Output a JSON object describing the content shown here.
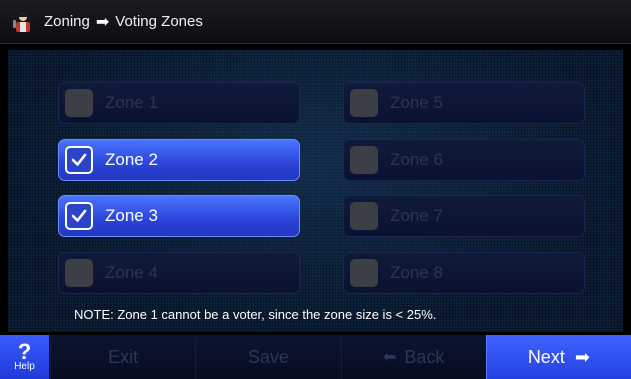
{
  "header": {
    "icon": "technician-icon",
    "crumb_1": "Zoning",
    "crumb_arrow": "➡",
    "crumb_2": "Voting Zones"
  },
  "zones": [
    {
      "label": "Zone 1",
      "checked": false,
      "enabled": false
    },
    {
      "label": "Zone 2",
      "checked": true,
      "enabled": true
    },
    {
      "label": "Zone 3",
      "checked": true,
      "enabled": true
    },
    {
      "label": "Zone 4",
      "checked": false,
      "enabled": false
    },
    {
      "label": "Zone 5",
      "checked": false,
      "enabled": false
    },
    {
      "label": "Zone 6",
      "checked": false,
      "enabled": false
    },
    {
      "label": "Zone 7",
      "checked": false,
      "enabled": false
    },
    {
      "label": "Zone 8",
      "checked": false,
      "enabled": false
    }
  ],
  "note": "NOTE: Zone 1 cannot be a voter, since the zone size is < 25%.",
  "footer": {
    "help_symbol": "?",
    "help_label": "Help",
    "exit_label": "Exit",
    "save_label": "Save",
    "back_icon": "⬅",
    "back_label": "Back",
    "next_label": "Next",
    "next_icon": "➡"
  },
  "colors": {
    "accent": "#3a5bff",
    "checked_button": "#2a44d8",
    "disabled_button": "#0f1a3a"
  }
}
